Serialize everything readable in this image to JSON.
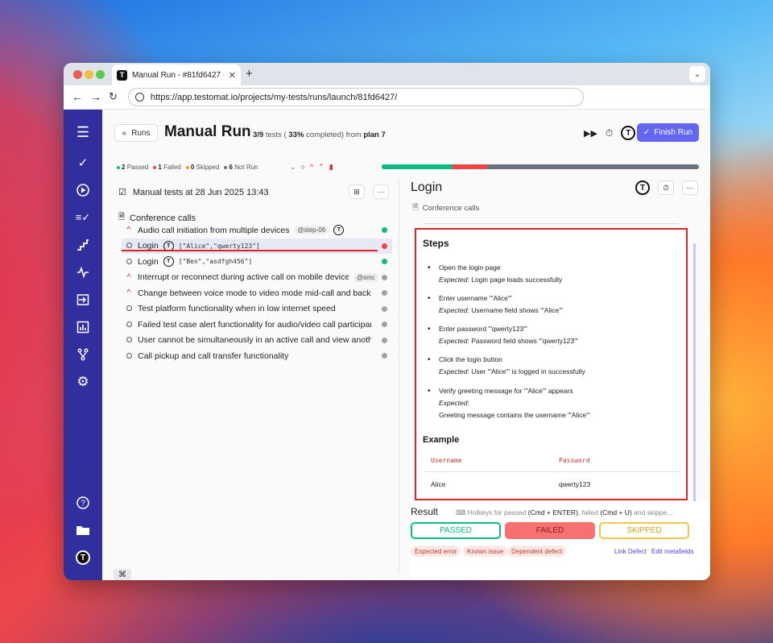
{
  "browser": {
    "tab_title": "Manual Run - #81fd6427 - Te",
    "tab_close": "✕",
    "new_tab": "+",
    "url": "https://app.testomat.io/projects/my-tests/runs/launch/81fd6427/"
  },
  "header": {
    "back_label": "Runs",
    "title": "Manual Run",
    "progress_prefix": "3/9",
    "progress_mid": " tests ( ",
    "progress_pct": "33%",
    "progress_mid2": " completed) from ",
    "progress_plan": "plan 7",
    "finish_label": "Finish Run"
  },
  "stats": {
    "passed_count": "2",
    "passed_label": "Passed",
    "failed_count": "1",
    "failed_label": "Failed",
    "skipped_count": "0",
    "skipped_label": "Skipped",
    "notrun_count": "6",
    "notrun_label": "Not Run"
  },
  "progress": {
    "passed": 2,
    "failed": 1,
    "total": 9,
    "colors": {
      "passed": "#10b981",
      "failed": "#ef4444",
      "notrun": "#6b7280"
    }
  },
  "left": {
    "suite_title": "Manual tests at 28 Jun 2025 13:43",
    "group_title": "Conference calls",
    "tests": [
      {
        "name": "Audio call initiation from multiple devices",
        "tag": "@step-06",
        "status": "passed",
        "marker": "up",
        "logo": true
      },
      {
        "name": "Login",
        "code": "[\"Alice\",\"qwerty123\"]",
        "status": "failed",
        "marker": "circle",
        "logo": true,
        "selected": true
      },
      {
        "name": "Login",
        "code": "[\"Ben\",\"asdfgh456\"]",
        "status": "passed",
        "marker": "circle",
        "logo": true
      },
      {
        "name": "Interrupt or reconnect during active call on mobile device",
        "tag": "@smc",
        "status": "none",
        "marker": "up"
      },
      {
        "name": "Change between voice mode to video mode mid-call and back",
        "status": "none",
        "marker": "up"
      },
      {
        "name": "Test platform functionality when in low internet speed",
        "status": "none",
        "marker": "circle"
      },
      {
        "name": "Failed test case alert functionality for audio/video call participar",
        "status": "none",
        "marker": "circle"
      },
      {
        "name": "User cannot be simultaneously in an active call and view anothe",
        "status": "none",
        "marker": "circle"
      },
      {
        "name": "Call pickup and call transfer functionality",
        "status": "none",
        "marker": "circle"
      }
    ]
  },
  "right": {
    "title": "Login",
    "suite": "Conference calls",
    "steps_heading": "Steps",
    "expected_label": "Expected",
    "steps": [
      {
        "action": "Open the login page",
        "expected": "Login page loads successfully"
      },
      {
        "action": "Enter username '\"Alice\"'",
        "expected": "Username field shows '\"Alice\"'"
      },
      {
        "action": "Enter password '\"qwerty123\"'",
        "expected": "Password field shows '\"qwerty123\"'"
      },
      {
        "action": "Click the login button",
        "expected": "User '\"Alice\"' is logged in successfully"
      },
      {
        "action": "Verify greeting message for '\"Alice\"' appears",
        "expected": "",
        "expected_extra": "Greeting message contains the username '\"Alice\"'"
      }
    ],
    "example_heading": "Example",
    "example_cols": [
      "Username",
      "Password"
    ],
    "example_row": [
      "Alice",
      "qwerty123"
    ],
    "result_label": "Result",
    "hotkeys_text": "Hotkeys for passed",
    "hotkeys_passed": "(Cmd + ENTER)",
    "hotkeys_mid": ", failed",
    "hotkeys_failed": "(Cmd + U)",
    "hotkeys_tail": " and skippe...",
    "btn_passed": "PASSED",
    "btn_failed": "FAILED",
    "btn_skipped": "SKIPPED",
    "chips": [
      "Expected error",
      "Known issue",
      "Dependent defect"
    ],
    "link_defect": "Link Defect",
    "edit_meta": "Edit metafields"
  },
  "kbd": "⌘"
}
